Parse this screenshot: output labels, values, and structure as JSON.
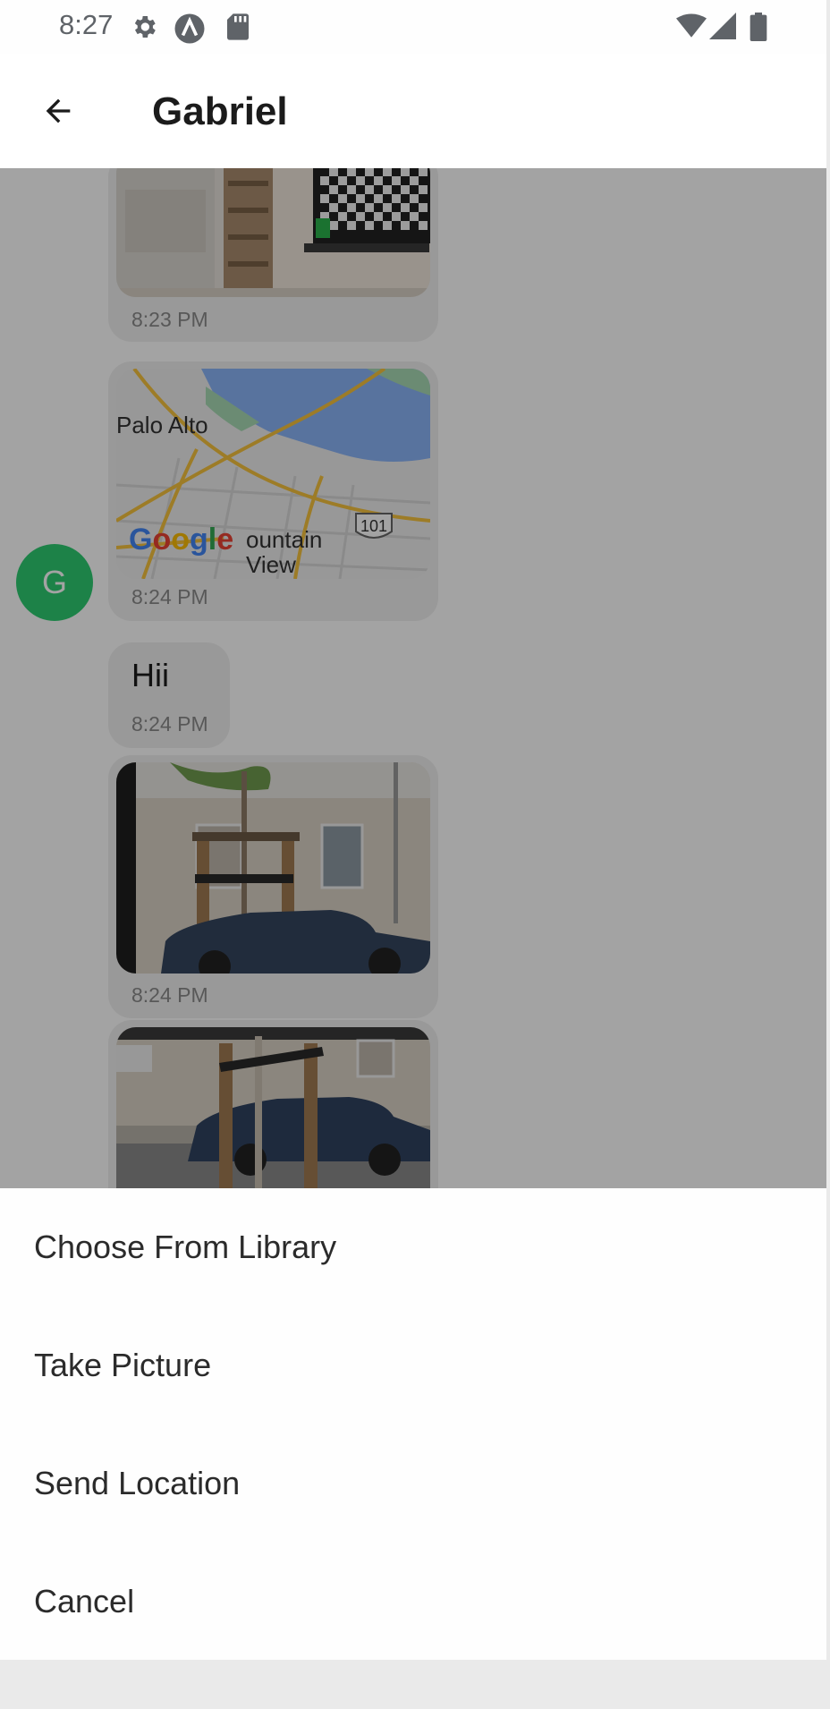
{
  "status_bar": {
    "time": "8:27",
    "icons": [
      "gear-icon",
      "a-icon",
      "sd-card-icon",
      "wifi-icon",
      "signal-icon",
      "battery-icon"
    ]
  },
  "header": {
    "back_icon": "arrow-left-icon",
    "title": "Gabriel"
  },
  "messages": [
    {
      "type": "image",
      "description": "photo",
      "time": "8:23 PM"
    },
    {
      "type": "map",
      "labels": [
        "Palo Alto",
        "Google",
        "Mountain View",
        "101"
      ],
      "time": "8:24 PM"
    },
    {
      "type": "text",
      "text": "Hii",
      "time": "8:24 PM"
    },
    {
      "type": "image",
      "description": "photo",
      "time": "8:24 PM"
    },
    {
      "type": "image",
      "description": "photo"
    }
  ],
  "avatar": {
    "initial": "G",
    "color": "#2ecc71"
  },
  "map": {
    "city_label": "Palo Alto",
    "logo": {
      "G": "G",
      "o1": "o",
      "o2": "o",
      "g": "g",
      "l": "l",
      "e": "e"
    },
    "city2_line1": "ountain",
    "city2_line2": "View",
    "shield": "101"
  },
  "action_sheet": {
    "items": [
      {
        "label": "Choose From Library"
      },
      {
        "label": "Take Picture"
      },
      {
        "label": "Send Location"
      },
      {
        "label": "Cancel"
      }
    ]
  },
  "colors": {
    "scrim": "rgba(0,0,0,0.36)",
    "bubble": "#f0f0f0",
    "avatar": "#2ecc71",
    "map_water": "#8ab4f8",
    "map_road": "#f6c23e"
  }
}
